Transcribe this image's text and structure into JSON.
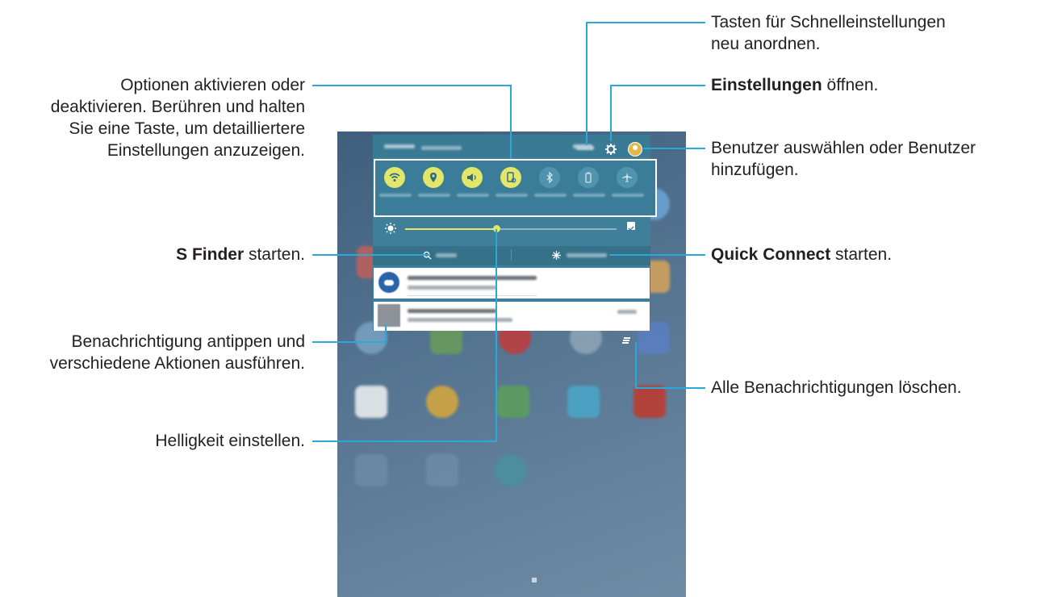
{
  "callouts": {
    "rearrange": {
      "line1": "Tasten für Schnelleinstellungen",
      "line2": "neu anordnen."
    },
    "settings": {
      "bold": "Einstellungen",
      "rest": " öffnen."
    },
    "user": {
      "line1": "Benutzer auswählen oder Benutzer",
      "line2": "hinzufügen."
    },
    "quick_connect": {
      "bold": "Quick Connect",
      "rest": " starten."
    },
    "clear_all": {
      "text": "Alle Benachrichtigungen löschen."
    },
    "options": {
      "line1": "Optionen aktivieren oder",
      "line2": "deaktivieren. Berühren und halten",
      "line3": "Sie eine Taste, um detailliertere",
      "line4": "Einstellungen anzuzeigen."
    },
    "s_finder": {
      "bold": "S Finder",
      "rest": " starten."
    },
    "notification": {
      "line1": "Benachrichtigung antippen und",
      "line2": "verschiedene Aktionen ausführen."
    },
    "brightness": {
      "text": "Helligkeit einstellen."
    }
  },
  "tablet": {
    "quick_settings": [
      {
        "icon": "wifi-icon"
      },
      {
        "icon": "location-icon"
      },
      {
        "icon": "sound-icon"
      },
      {
        "icon": "screen-mirroring-icon"
      },
      {
        "icon": "bluetooth-icon"
      },
      {
        "icon": "power-saving-icon"
      },
      {
        "icon": "airplane-mode-icon"
      }
    ],
    "brightness_level": 0.43,
    "colors": {
      "accent": "#e2e76a",
      "panel": "#3f7f99",
      "wallpaper": "#53728f",
      "leader_line": "#2aa9d8"
    }
  }
}
